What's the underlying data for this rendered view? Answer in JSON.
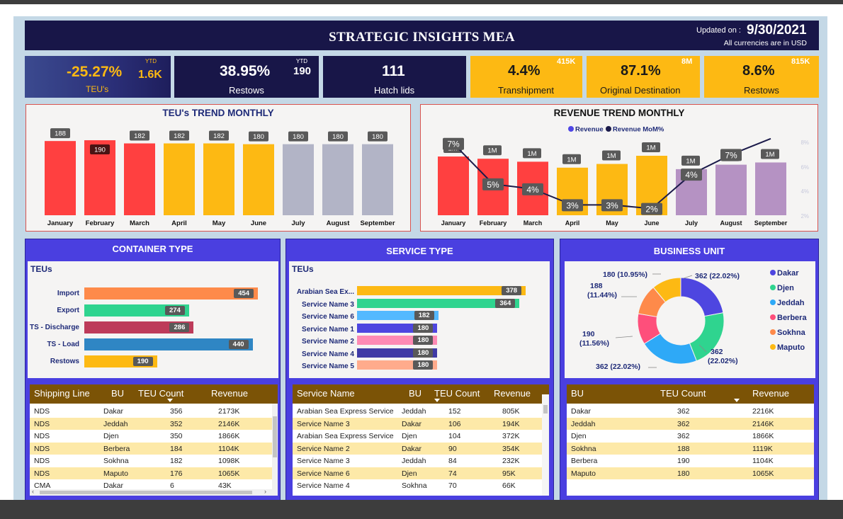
{
  "header": {
    "title": "STRATEGIC INSIGHTS MEA",
    "updated_label": "Updated on :",
    "updated_date": "9/30/2021",
    "currency_note": "All currencies are in USD"
  },
  "kpis": [
    {
      "value": "-25.27%",
      "label": "TEU's",
      "ytd_tag": "YTD",
      "ytd_value": "1.6K"
    },
    {
      "value": "38.95%",
      "label": "Restows",
      "ytd_tag": "YTD",
      "ytd_value": "190"
    },
    {
      "value": "111",
      "label": "Hatch lids"
    },
    {
      "value": "4.4%",
      "label": "Transhipment",
      "corner": "415K"
    },
    {
      "value": "87.1%",
      "label": "Original Destination",
      "corner": "8M"
    },
    {
      "value": "8.6%",
      "label": "Restows",
      "corner": "815K"
    }
  ],
  "teu_trend": {
    "title": "TEU's TREND MONTHLY",
    "chart_data": {
      "type": "bar",
      "categories": [
        "January",
        "February",
        "March",
        "April",
        "May",
        "June",
        "July",
        "August",
        "September"
      ],
      "values": [
        188,
        190,
        182,
        182,
        182,
        180,
        180,
        180,
        180
      ],
      "colors": [
        "#ff4040",
        "#ff4040",
        "#ff4040",
        "#fdb913",
        "#fdb913",
        "#fdb913",
        "#b2b4c6",
        "#b2b4c6",
        "#b2b4c6"
      ]
    }
  },
  "revenue_trend": {
    "title": "REVENUE TREND MONTHLY",
    "legend": [
      "Revenue",
      "Revenue MoM%"
    ],
    "legend_colors": [
      "#4f46e5",
      "#1b1a4a"
    ],
    "right_axis_ticks": [
      "8%",
      "6%",
      "4%",
      "2%"
    ],
    "chart_data": {
      "type": "bar",
      "categories": [
        "January",
        "February",
        "March",
        "April",
        "May",
        "June",
        "July",
        "August",
        "September"
      ],
      "series": [
        {
          "name": "Revenue",
          "labels": [
            "1M",
            "1M",
            "1M",
            "1M",
            "1M",
            "1M",
            "1M",
            "1M",
            "1M"
          ],
          "values": [
            0.79,
            0.76,
            0.72,
            0.64,
            0.69,
            0.8,
            0.62,
            0.68,
            0.71
          ]
        },
        {
          "name": "Revenue MoM%",
          "labels": [
            "7%",
            "5%",
            "4%",
            "3%",
            "3%",
            "2%",
            "4%",
            "7%",
            ""
          ],
          "values": [
            7.9,
            4.6,
            4.2,
            2.9,
            2.9,
            2.6,
            5.4,
            7.0,
            8.3
          ]
        }
      ],
      "colors": [
        "#ff4040",
        "#ff4040",
        "#ff4040",
        "#fdb913",
        "#fdb913",
        "#fdb913",
        "#b592c3",
        "#b592c3",
        "#b592c3"
      ]
    }
  },
  "container_type": {
    "title": "CONTAINER TYPE",
    "subtitle": "TEUs",
    "chart_data": {
      "type": "bar",
      "categories": [
        "Import",
        "Export",
        "TS - Discharge",
        "TS - Load",
        "Restows"
      ],
      "values": [
        454,
        274,
        286,
        440,
        190
      ],
      "colors": [
        "#fe8a4a",
        "#2fd48f",
        "#bd3b5a",
        "#2f86c4",
        "#fdb913"
      ]
    },
    "table": {
      "headers": [
        "Shipping Line",
        "BU",
        "TEU Count",
        "Revenue"
      ],
      "rows": [
        [
          "NDS",
          "Dakar",
          "356",
          "2173K"
        ],
        [
          "NDS",
          "Jeddah",
          "352",
          "2146K"
        ],
        [
          "NDS",
          "Djen",
          "350",
          "1866K"
        ],
        [
          "NDS",
          "Berbera",
          "184",
          "1104K"
        ],
        [
          "NDS",
          "Sokhna",
          "182",
          "1098K"
        ],
        [
          "NDS",
          "Maputo",
          "176",
          "1065K"
        ],
        [
          "CMA",
          "Dakar",
          "6",
          "43K"
        ]
      ]
    }
  },
  "service_type": {
    "title": "SERVICE TYPE",
    "subtitle": "TEUs",
    "chart_data": {
      "type": "bar",
      "categories": [
        "Arabian Sea Ex...",
        "Service Name 3",
        "Service Name 6",
        "Service Name 1",
        "Service Name 2",
        "Service Name 4",
        "Service Name 5"
      ],
      "values": [
        378,
        364,
        182,
        180,
        180,
        180,
        180
      ],
      "colors": [
        "#fdb913",
        "#2fd48f",
        "#54b9ff",
        "#4e46e0",
        "#fe8ab4",
        "#3f3aa6",
        "#ffab8c"
      ]
    },
    "table": {
      "headers": [
        "Service Name",
        "BU",
        "TEU Count",
        "Revenue"
      ],
      "rows": [
        [
          "Arabian Sea Express Service",
          "Jeddah",
          "152",
          "805K"
        ],
        [
          "Service Name 3",
          "Dakar",
          "106",
          "194K"
        ],
        [
          "Arabian Sea Express Service",
          "Djen",
          "104",
          "372K"
        ],
        [
          "Service Name 2",
          "Dakar",
          "90",
          "354K"
        ],
        [
          "Service Name 3",
          "Jeddah",
          "84",
          "232K"
        ],
        [
          "Service Name 6",
          "Djen",
          "74",
          "95K"
        ],
        [
          "Service Name 4",
          "Sokhna",
          "70",
          "66K"
        ]
      ]
    }
  },
  "business_unit": {
    "title": "BUSINESS UNIT",
    "chart_data": {
      "type": "pie",
      "categories": [
        "Dakar",
        "Djen",
        "Jeddah",
        "Berbera",
        "Sokhna",
        "Maputo"
      ],
      "values": [
        362,
        362,
        362,
        190,
        188,
        180
      ],
      "labels": [
        "362 (22.02%)",
        "362 (22.02%)",
        "362 (22.02%)",
        "190 (11.56%)",
        "188 (11.44%)",
        "180 (10.95%)"
      ],
      "colors": [
        "#4e46e0",
        "#2fd48f",
        "#2ea9f7",
        "#fe4f7b",
        "#fe8a4a",
        "#fdb913"
      ]
    },
    "table": {
      "headers": [
        "BU",
        "TEU Count",
        "Revenue"
      ],
      "rows": [
        [
          "Dakar",
          "362",
          "2216K"
        ],
        [
          "Jeddah",
          "362",
          "2146K"
        ],
        [
          "Djen",
          "362",
          "1866K"
        ],
        [
          "Sokhna",
          "188",
          "1119K"
        ],
        [
          "Berbera",
          "190",
          "1104K"
        ],
        [
          "Maputo",
          "180",
          "1065K"
        ]
      ]
    }
  }
}
